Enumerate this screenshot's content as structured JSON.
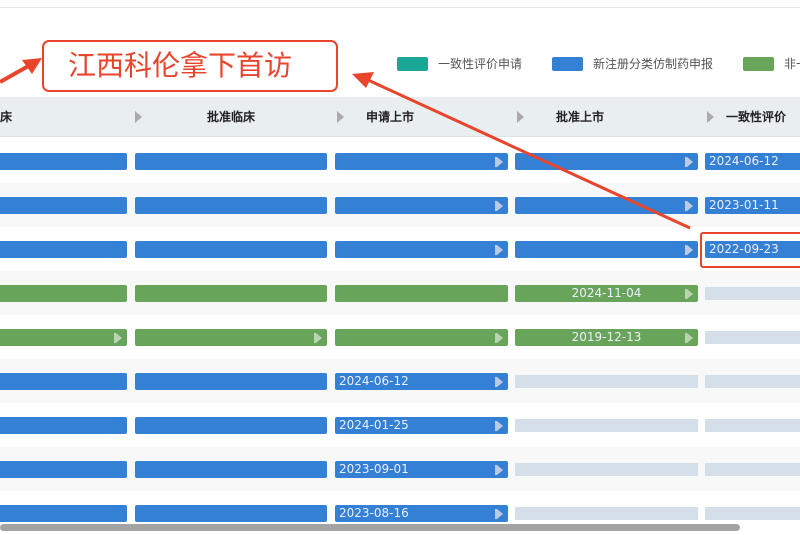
{
  "legend": [
    {
      "label": "一致性评价申请",
      "color": "#19a796"
    },
    {
      "label": "新注册分类仿制药申报",
      "color": "#3480d4"
    },
    {
      "label": "非一",
      "color": "#68a55a"
    }
  ],
  "columns": [
    "临床",
    "批准临床",
    "申请上市",
    "批准上市",
    "一致性评价"
  ],
  "annotation": {
    "text": "江西科伦拿下首访",
    "color": "#e8452c"
  },
  "rows": [
    {
      "color": "blue",
      "cells": [
        {
          "t": "bar"
        },
        {
          "t": "bar"
        },
        {
          "t": "bar",
          "arrow": true
        },
        {
          "t": "bar",
          "arrow": true
        },
        {
          "t": "bar",
          "date": "2024-06-12"
        }
      ]
    },
    {
      "color": "blue",
      "cells": [
        {
          "t": "bar"
        },
        {
          "t": "bar"
        },
        {
          "t": "bar",
          "arrow": true
        },
        {
          "t": "bar",
          "arrow": true
        },
        {
          "t": "bar",
          "date": "2023-01-11"
        }
      ]
    },
    {
      "color": "blue",
      "cells": [
        {
          "t": "bar"
        },
        {
          "t": "bar"
        },
        {
          "t": "bar",
          "arrow": true
        },
        {
          "t": "bar",
          "arrow": true
        },
        {
          "t": "bar",
          "date": "2022-09-23",
          "highlight": true
        }
      ]
    },
    {
      "color": "green",
      "cells": [
        {
          "t": "bar"
        },
        {
          "t": "bar"
        },
        {
          "t": "bar"
        },
        {
          "t": "bar",
          "date": "2024-11-04",
          "arrow": true,
          "center": true
        },
        {
          "t": "empty"
        }
      ]
    },
    {
      "color": "green",
      "cells": [
        {
          "t": "bar",
          "arrow": true
        },
        {
          "t": "bar",
          "arrow": true
        },
        {
          "t": "bar",
          "arrow": true
        },
        {
          "t": "bar",
          "date": "2019-12-13",
          "arrow": true,
          "center": true
        },
        {
          "t": "empty"
        }
      ]
    },
    {
      "color": "blue",
      "cells": [
        {
          "t": "bar"
        },
        {
          "t": "bar"
        },
        {
          "t": "bar",
          "date": "2024-06-12",
          "arrow": true
        },
        {
          "t": "empty"
        },
        {
          "t": "empty"
        }
      ]
    },
    {
      "color": "blue",
      "cells": [
        {
          "t": "bar"
        },
        {
          "t": "bar"
        },
        {
          "t": "bar",
          "date": "2024-01-25",
          "arrow": true
        },
        {
          "t": "empty"
        },
        {
          "t": "empty"
        }
      ]
    },
    {
      "color": "blue",
      "cells": [
        {
          "t": "bar"
        },
        {
          "t": "bar"
        },
        {
          "t": "bar",
          "date": "2023-09-01",
          "arrow": true
        },
        {
          "t": "empty"
        },
        {
          "t": "empty"
        }
      ]
    },
    {
      "color": "blue",
      "cells": [
        {
          "t": "bar"
        },
        {
          "t": "bar"
        },
        {
          "t": "bar",
          "date": "2023-08-16",
          "arrow": true
        },
        {
          "t": "empty"
        },
        {
          "t": "empty"
        }
      ]
    }
  ]
}
